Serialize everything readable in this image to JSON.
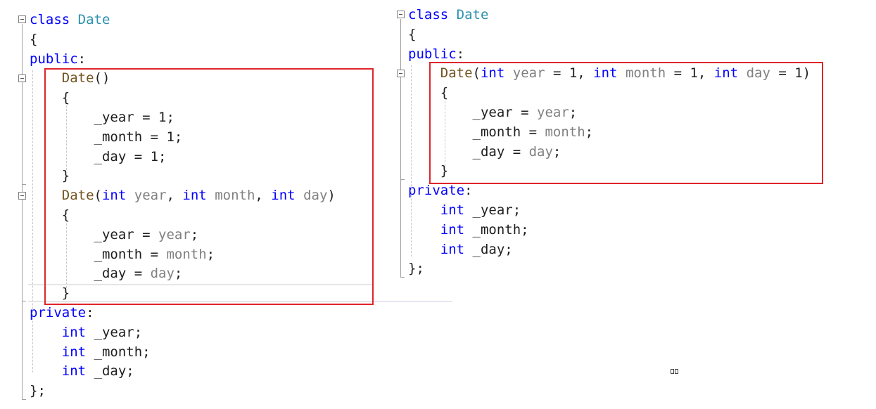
{
  "left_panel": {
    "lines": [
      {
        "tokens": [
          [
            "kw",
            "class"
          ],
          [
            "plain",
            " "
          ],
          [
            "type",
            "Date"
          ]
        ]
      },
      {
        "tokens": [
          [
            "plain",
            "{"
          ]
        ]
      },
      {
        "tokens": [
          [
            "kw",
            "public"
          ],
          [
            "plain",
            ":"
          ]
        ]
      },
      {
        "tokens": [
          [
            "plain",
            "    "
          ],
          [
            "fn",
            "Date"
          ],
          [
            "plain",
            "()"
          ]
        ]
      },
      {
        "tokens": [
          [
            "plain",
            "    {"
          ]
        ]
      },
      {
        "tokens": [
          [
            "plain",
            "        _year = 1;"
          ]
        ]
      },
      {
        "tokens": [
          [
            "plain",
            "        _month = 1;"
          ]
        ]
      },
      {
        "tokens": [
          [
            "plain",
            "        _day = 1;"
          ]
        ]
      },
      {
        "tokens": [
          [
            "plain",
            "    }"
          ]
        ]
      },
      {
        "tokens": [
          [
            "plain",
            "    "
          ],
          [
            "fn",
            "Date"
          ],
          [
            "plain",
            "("
          ],
          [
            "kw",
            "int"
          ],
          [
            "plain",
            " "
          ],
          [
            "param",
            "year"
          ],
          [
            "plain",
            ", "
          ],
          [
            "kw",
            "int"
          ],
          [
            "plain",
            " "
          ],
          [
            "param",
            "month"
          ],
          [
            "plain",
            ", "
          ],
          [
            "kw",
            "int"
          ],
          [
            "plain",
            " "
          ],
          [
            "param",
            "day"
          ],
          [
            "plain",
            ")"
          ]
        ]
      },
      {
        "tokens": [
          [
            "plain",
            "    {"
          ]
        ]
      },
      {
        "tokens": [
          [
            "plain",
            "        _year = "
          ],
          [
            "param",
            "year"
          ],
          [
            "plain",
            ";"
          ]
        ]
      },
      {
        "tokens": [
          [
            "plain",
            "        _month = "
          ],
          [
            "param",
            "month"
          ],
          [
            "plain",
            ";"
          ]
        ]
      },
      {
        "tokens": [
          [
            "plain",
            "        _day = "
          ],
          [
            "param",
            "day"
          ],
          [
            "plain",
            ";"
          ]
        ]
      },
      {
        "tokens": [
          [
            "plain",
            "    }"
          ]
        ]
      },
      {
        "tokens": [
          [
            "kw",
            "private"
          ],
          [
            "plain",
            ":"
          ]
        ]
      },
      {
        "tokens": [
          [
            "plain",
            "    "
          ],
          [
            "kw",
            "int"
          ],
          [
            "plain",
            " _year;"
          ]
        ]
      },
      {
        "tokens": [
          [
            "plain",
            "    "
          ],
          [
            "kw",
            "int"
          ],
          [
            "plain",
            " _month;"
          ]
        ]
      },
      {
        "tokens": [
          [
            "plain",
            "    "
          ],
          [
            "kw",
            "int"
          ],
          [
            "plain",
            " _day;"
          ]
        ]
      },
      {
        "tokens": [
          [
            "plain",
            "};"
          ]
        ]
      }
    ]
  },
  "right_panel": {
    "lines": [
      {
        "tokens": [
          [
            "kw",
            "class"
          ],
          [
            "plain",
            " "
          ],
          [
            "type",
            "Date"
          ]
        ]
      },
      {
        "tokens": [
          [
            "plain",
            "{"
          ]
        ]
      },
      {
        "tokens": [
          [
            "kw",
            "public"
          ],
          [
            "plain",
            ":"
          ]
        ]
      },
      {
        "tokens": [
          [
            "plain",
            "    "
          ],
          [
            "fn",
            "Date"
          ],
          [
            "plain",
            "("
          ],
          [
            "kw",
            "int"
          ],
          [
            "plain",
            " "
          ],
          [
            "param",
            "year"
          ],
          [
            "plain",
            " = 1, "
          ],
          [
            "kw",
            "int"
          ],
          [
            "plain",
            " "
          ],
          [
            "param",
            "month"
          ],
          [
            "plain",
            " = 1, "
          ],
          [
            "kw",
            "int"
          ],
          [
            "plain",
            " "
          ],
          [
            "param",
            "day"
          ],
          [
            "plain",
            " = 1)"
          ]
        ]
      },
      {
        "tokens": [
          [
            "plain",
            "    {"
          ]
        ]
      },
      {
        "tokens": [
          [
            "plain",
            "        _year = "
          ],
          [
            "param",
            "year"
          ],
          [
            "plain",
            ";"
          ]
        ]
      },
      {
        "tokens": [
          [
            "plain",
            "        _month = "
          ],
          [
            "param",
            "month"
          ],
          [
            "plain",
            ";"
          ]
        ]
      },
      {
        "tokens": [
          [
            "plain",
            "        _day = "
          ],
          [
            "param",
            "day"
          ],
          [
            "plain",
            ";"
          ]
        ]
      },
      {
        "tokens": [
          [
            "plain",
            "    }"
          ]
        ]
      },
      {
        "tokens": [
          [
            "kw",
            "private"
          ],
          [
            "plain",
            ":"
          ]
        ]
      },
      {
        "tokens": [
          [
            "plain",
            "    "
          ],
          [
            "kw",
            "int"
          ],
          [
            "plain",
            " _year;"
          ]
        ]
      },
      {
        "tokens": [
          [
            "plain",
            "    "
          ],
          [
            "kw",
            "int"
          ],
          [
            "plain",
            " _month;"
          ]
        ]
      },
      {
        "tokens": [
          [
            "plain",
            "    "
          ],
          [
            "kw",
            "int"
          ],
          [
            "plain",
            " _day;"
          ]
        ]
      },
      {
        "tokens": [
          [
            "plain",
            "};"
          ]
        ]
      }
    ]
  },
  "colors": {
    "keyword": "#0000ff",
    "type": "#2b91af",
    "function": "#74531f",
    "parameter": "#808080",
    "text": "#1e1e1e",
    "highlight_box": "#e0252b"
  }
}
